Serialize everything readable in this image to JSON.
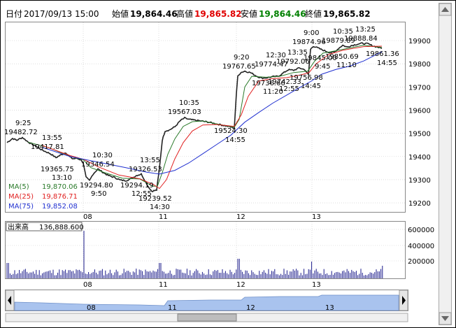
{
  "header": {
    "date_label": "日付",
    "date_value": "2017/09/13 15:00",
    "open_label": "始値",
    "open_value": "19,864.46",
    "high_label": "高値",
    "high_value": "19,865.82",
    "low_label": "安値",
    "low_value": "19,864.46",
    "close_label": "終値",
    "close_value": "19,865.82"
  },
  "colors": {
    "ma5": "#2a7a2a",
    "ma25": "#e02020",
    "ma75": "#2030d0",
    "high": "#e00000",
    "low": "#008000",
    "volume": "#1a1a8a",
    "scroll_fill": "#a9c3ee"
  },
  "legend": [
    {
      "label": "MA(5)",
      "value": "19,870.06",
      "color": "#2a7a2a"
    },
    {
      "label": "MA(25)",
      "value": "19,876.71",
      "color": "#e02020"
    },
    {
      "label": "MA(75)",
      "value": "19,852.08",
      "color": "#2030d0"
    }
  ],
  "volume_panel": {
    "label": "出来高",
    "value": "136,888.600",
    "ticks": [
      "600000",
      "400000",
      "200000"
    ]
  },
  "y_ticks": [
    "19900",
    "19800",
    "19700",
    "19600",
    "19500",
    "19400",
    "19300",
    "19200"
  ],
  "x_ticks": [
    "08",
    "11",
    "12",
    "13"
  ],
  "scroll_ticks": [
    "08",
    "11",
    "12",
    "13"
  ],
  "annotations": [
    {
      "time": "9:25",
      "price": "19482.72"
    },
    {
      "time": "13:55",
      "price": "19417.81"
    },
    {
      "time": "13:10",
      "price": "19365.75"
    },
    {
      "time": "10:30",
      "price": "19346.54"
    },
    {
      "time": "13:55",
      "price": "19326.53"
    },
    {
      "time": "9:50",
      "price": "19294.80"
    },
    {
      "time": "12:55",
      "price": "19294.19"
    },
    {
      "time": "14:30",
      "price": "19239.52"
    },
    {
      "time": "10:35",
      "price": "19567.03"
    },
    {
      "time": "14:55",
      "price": "19524.30"
    },
    {
      "time": "9:20",
      "price": "19767.65"
    },
    {
      "time": "12:30",
      "price": "19774.47"
    },
    {
      "time": "13:35",
      "price": "19792.06"
    },
    {
      "time": "11:20",
      "price": "19736.66"
    },
    {
      "time": "12:55",
      "price": "19742.33"
    },
    {
      "time": "14:45",
      "price": "19756.98"
    },
    {
      "time": "9:00",
      "price": "19874.96"
    },
    {
      "time": "10:35",
      "price": "19879.89"
    },
    {
      "time": "13:25",
      "price": "19888.84"
    },
    {
      "time": "9:45",
      "price": "19845.00"
    },
    {
      "time": "11:10",
      "price": "19850.69"
    },
    {
      "time": "14:55",
      "price": "19861.36"
    }
  ]
}
